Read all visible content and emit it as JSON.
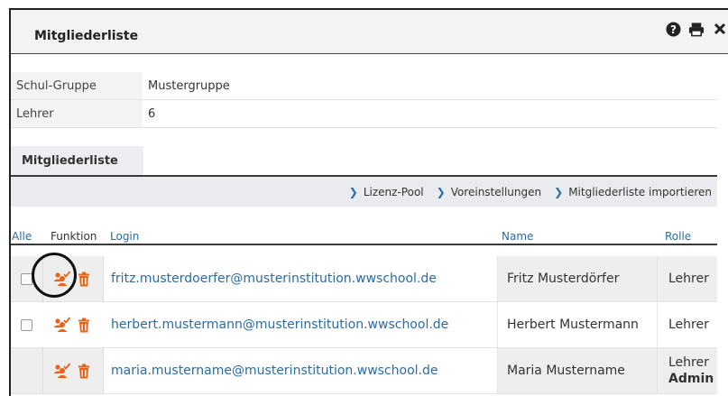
{
  "window": {
    "title": "Mitgliederliste",
    "icons": [
      "help-icon",
      "print-icon",
      "close-icon"
    ]
  },
  "info": [
    {
      "key": "Schul-Gruppe",
      "value": "Mustergruppe"
    },
    {
      "key": "Lehrer",
      "value": "6"
    }
  ],
  "tab": {
    "label": "Mitgliederliste"
  },
  "toolbar": {
    "links": [
      "Lizenz-Pool",
      "Voreinstellungen",
      "Mitgliederliste importieren"
    ]
  },
  "table": {
    "headers": {
      "all": "Alle",
      "funktion": "Funktion",
      "login": "Login",
      "name": "Name",
      "rolle": "Rolle"
    },
    "rows": [
      {
        "login": "fritz.musterdoerfer@musterinstitution.wwschool.de",
        "name": "Fritz Musterdörfer",
        "role": "Lehrer",
        "role2": ""
      },
      {
        "login": "herbert.mustermann@musterinstitution.wwschool.de",
        "name": "Herbert Mustermann",
        "role": "Lehrer",
        "role2": ""
      },
      {
        "login": "maria.mustername@musterinstitution.wwschool.de",
        "name": "Maria Mustername",
        "role": "Lehrer",
        "role2": "Admin"
      }
    ]
  },
  "colors": {
    "accent": "#e8621a",
    "link": "#2b6ca3"
  }
}
